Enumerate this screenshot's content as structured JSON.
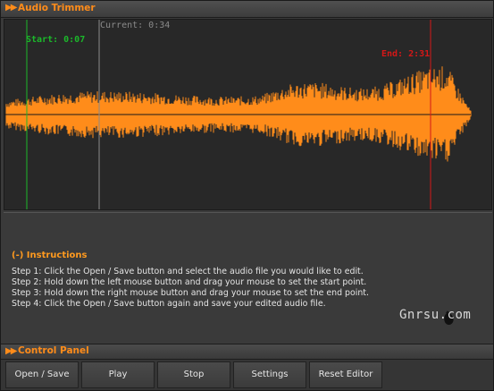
{
  "window": {
    "title": "Audio Trimmer"
  },
  "waveform": {
    "wave_color": "#ff8c1a",
    "background": "#282828",
    "start_marker": {
      "label": "Start: 0:07",
      "color": "#1bb82a"
    },
    "current_marker": {
      "label": "Current: 0:34",
      "color": "#8a8a8a"
    },
    "end_marker": {
      "label": "End: 2:31",
      "color": "#d61717"
    }
  },
  "instructions": {
    "heading": "(-) Instructions",
    "steps": [
      "Step 1: Click the Open / Save button and select the audio file you would like to edit.",
      "Step 2: Hold down the left mouse button and drag your mouse to set the start point.",
      "Step 3: Hold down the right mouse button and drag your mouse to set the end point.",
      "Step 4: Click the Open / Save button again and save your edited audio file."
    ]
  },
  "watermark": {
    "text": "Gnrsu.com"
  },
  "control_panel": {
    "title": "Control Panel",
    "buttons": [
      "Open / Save",
      "Play",
      "Stop",
      "Settings",
      "Reset Editor"
    ]
  },
  "icons": {
    "collapse_arrows": "double-right-arrow-icon"
  }
}
